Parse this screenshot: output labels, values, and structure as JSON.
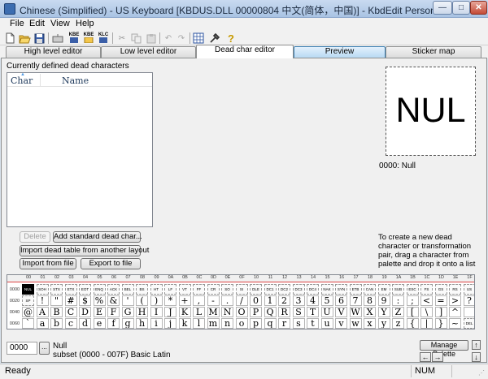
{
  "window": {
    "title": "Chinese (Simplified) - US Keyboard [KBDUS.DLL 00000804 中文(简体，中国)] - KbdEdit Personal",
    "min_glyph": "—",
    "max_glyph": "□",
    "close_glyph": "✕"
  },
  "menu": {
    "items": [
      "File",
      "Edit",
      "View",
      "Help"
    ]
  },
  "toolbar": {
    "kbe_label": "KBE",
    "klc_label": "KLC"
  },
  "tabs": [
    "High level editor",
    "Low level editor",
    "Dead char editor",
    "Preview",
    "Sticker map"
  ],
  "deadchars": {
    "label": "Currently defined dead characters",
    "col_char": "Char",
    "col_name": "Name",
    "delete_button": "Delete",
    "add_button": "Add standard dead char...",
    "import_table_button": "Import dead table from another layout",
    "import_file_button": "Import from file",
    "export_file_button": "Export to file"
  },
  "preview": {
    "glyph": "NUL",
    "caption": "0000: Null",
    "help": "To create a new dead character or transformation pair, drag a character from palette and drop it onto a list"
  },
  "palette": {
    "col_headers": [
      "00",
      "01",
      "02",
      "03",
      "04",
      "05",
      "06",
      "07",
      "08",
      "09",
      "0A",
      "0B",
      "0C",
      "0D",
      "0E",
      "0F",
      "10",
      "11",
      "12",
      "13",
      "14",
      "15",
      "16",
      "17",
      "18",
      "19",
      "1A",
      "1B",
      "1C",
      "1D",
      "1E",
      "1F"
    ],
    "rows": [
      {
        "label": "0000",
        "cells": [
          "NUL",
          "SOH",
          "STX",
          "ETX",
          "EOT",
          "ENQ",
          "ACK",
          "BEL",
          "BS",
          "HT",
          "LF",
          "VT",
          "FF",
          "CR",
          "SO",
          "SI",
          "DLE",
          "DC1",
          "DC2",
          "DC3",
          "DC4",
          "NAK",
          "SYN",
          "ETB",
          "CAN",
          "EM",
          "SUB",
          "ESC",
          "FS",
          "GS",
          "RS",
          "US"
        ]
      },
      {
        "label": "0020",
        "cells": [
          "SP",
          "!",
          "\"",
          "#",
          "$",
          "%",
          "&",
          "'",
          "(",
          ")",
          "*",
          "+",
          ",",
          "-",
          ".",
          "/",
          "0",
          "1",
          "2",
          "3",
          "4",
          "5",
          "6",
          "7",
          "8",
          "9",
          ":",
          ";",
          "<",
          "=",
          ">",
          "?"
        ]
      },
      {
        "label": "0040",
        "cells": [
          "@",
          "A",
          "B",
          "C",
          "D",
          "E",
          "F",
          "G",
          "H",
          "I",
          "J",
          "K",
          "L",
          "M",
          "N",
          "O",
          "P",
          "Q",
          "R",
          "S",
          "T",
          "U",
          "V",
          "W",
          "X",
          "Y",
          "Z",
          "[",
          "\\",
          "]",
          "^",
          "_"
        ]
      },
      {
        "label": "0060",
        "cells": [
          "`",
          "a",
          "b",
          "c",
          "d",
          "e",
          "f",
          "g",
          "h",
          "i",
          "j",
          "k",
          "l",
          "m",
          "n",
          "o",
          "p",
          "q",
          "r",
          "s",
          "t",
          "u",
          "v",
          "w",
          "x",
          "y",
          "z",
          "{",
          "|",
          "}",
          "~",
          "DEL"
        ]
      }
    ]
  },
  "bottom": {
    "code_value": "0000",
    "code_button": "...",
    "name": "Null",
    "subset": "subset (0000 - 007F) Basic Latin",
    "palette_button": "Manage Palette",
    "up_arrow": "↑",
    "down_arrow": "↓",
    "left_arrow": "←",
    "right_arrow": "→"
  },
  "status": {
    "text": "Ready",
    "num": "NUM"
  }
}
